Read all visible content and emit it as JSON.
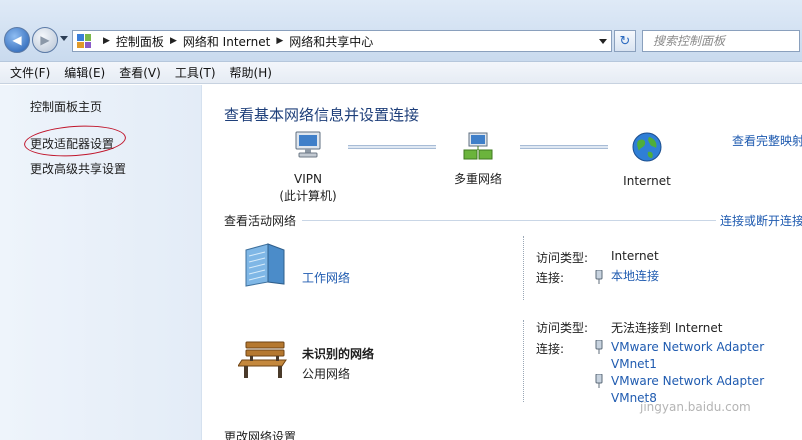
{
  "address_bar": {
    "breadcrumbs": [
      "控制面板",
      "网络和 Internet",
      "网络和共享中心"
    ],
    "search_placeholder": "搜索控制面板"
  },
  "menu": [
    "文件(F)",
    "编辑(E)",
    "查看(V)",
    "工具(T)",
    "帮助(H)"
  ],
  "sidebar": {
    "items": [
      {
        "label": "控制面板主页"
      },
      {
        "label": "更改适配器设置"
      },
      {
        "label": "更改高级共享设置"
      }
    ]
  },
  "main": {
    "title": "查看基本网络信息并设置连接",
    "view_full_map": "查看完整映射",
    "map": {
      "computer": {
        "line1": "VIPN",
        "line2": "(此计算机)"
      },
      "multi": {
        "label": "多重网络"
      },
      "internet": {
        "label": "Internet"
      }
    },
    "active_networks": {
      "label": "查看活动网络",
      "link": "连接或断开连接",
      "networks": [
        {
          "name": "工作网络",
          "type": "",
          "access_key": "访问类型:",
          "access_val": "Internet",
          "conn_key": "连接:",
          "connections": [
            "本地连接"
          ]
        },
        {
          "name": "未识别的网络",
          "type": "公用网络",
          "access_key": "访问类型:",
          "access_val": "无法连接到 Internet",
          "conn_key": "连接:",
          "connections": [
            "VMware Network Adapter VMnet1",
            "VMware Network Adapter VMnet8"
          ]
        }
      ]
    },
    "change_settings": "更改网络设置"
  },
  "watermark": "jingyan.baidu.com",
  "colors": {
    "link": "#1f5bb0",
    "title": "#1e3f7a",
    "annotation": "#c0152b"
  }
}
